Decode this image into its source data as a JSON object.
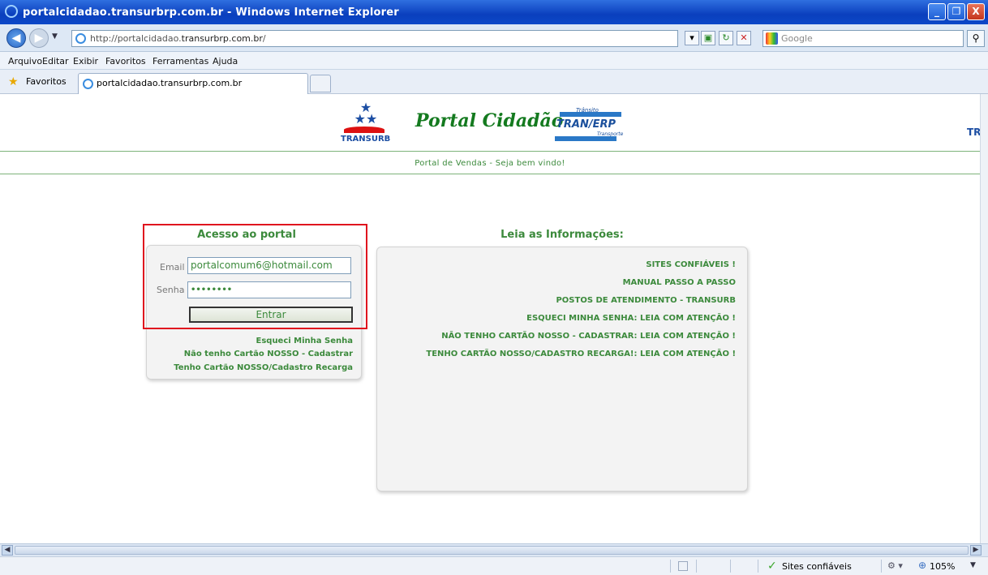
{
  "window": {
    "title": "portalcidadao.transurbrp.com.br - Windows Internet Explorer",
    "minimize_label": "_",
    "maximize_label": "❐",
    "close_label": "X"
  },
  "address_bar": {
    "url_prefix": "http://portalcidadao.",
    "url_domain": "transurbrp.com.br",
    "url_suffix": "/",
    "search_placeholder": "Google"
  },
  "menu": [
    "Arquivo",
    "Editar",
    "Exibir",
    "Favoritos",
    "Ferramentas",
    "Ajuda"
  ],
  "favorites_bar": {
    "favorites_label": "Favoritos",
    "tab_title": "portalcidadao.transurbrp.com.br"
  },
  "page": {
    "logo_left_label": "TRANSURB",
    "portal_title": "Portal Cidadão",
    "logo_center_small": "Trânsito",
    "logo_center_label": "TRAN/ERP",
    "logo_center_sub": "Transporte",
    "logo_right_label": "TR",
    "welcome": "Portal de Vendas - Seja bem vindo!"
  },
  "login": {
    "title": "Acesso ao portal",
    "email_label": "Email",
    "email_value": "portalcomum6@hotmail.com",
    "password_label": "Senha",
    "password_value": "••••••••",
    "enter_label": "Entrar",
    "links": [
      "Esqueci Minha Senha",
      "Não tenho Cartão NOSSO - Cadastrar",
      "Tenho Cartão NOSSO/Cadastro Recarga"
    ]
  },
  "info": {
    "title": "Leia as Informações:",
    "links": [
      "SITES CONFIÁVEIS !",
      "MANUAL PASSO A PASSO",
      "POSTOS DE ATENDIMENTO - TRANSURB",
      "ESQUECI MINHA SENHA: LEIA COM ATENÇÃO !",
      "NÃO TENHO CARTÃO NOSSO - CADASTRAR: LEIA COM ATENÇÃO !",
      "TENHO CARTÃO NOSSO/CADASTRO RECARGA!: LEIA COM ATENÇÃO !"
    ]
  },
  "status_bar": {
    "zone": "Sites confiáveis",
    "zoom": "105%"
  },
  "colors": {
    "accent_green": "#3c8a3c",
    "highlight_red": "#e0141e",
    "title_blue": "#0a3fbd"
  }
}
